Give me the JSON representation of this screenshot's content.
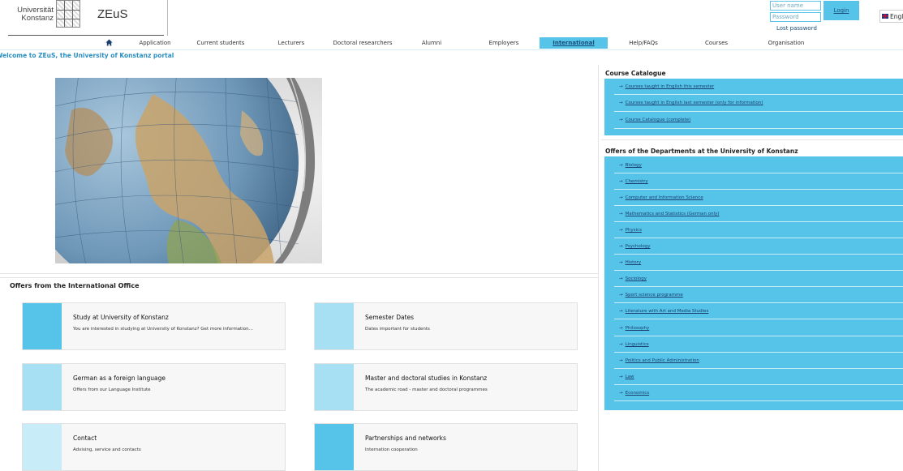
{
  "header": {
    "university_line1": "Universität",
    "university_line2": "Konstanz",
    "app_title": "ZEuS",
    "username_placeholder": "User name",
    "password_placeholder": "Password",
    "login_label": "Login",
    "lost_password": "Lost password",
    "language": "English"
  },
  "nav": {
    "items": [
      "Application",
      "Current students",
      "Lecturers",
      "Doctoral researchers",
      "Alumni",
      "Employers",
      "International",
      "Help/FAQs",
      "Courses",
      "Organisation"
    ],
    "active": "International"
  },
  "welcome": "Welcome to ZEuS, the University of Konstanz portal",
  "international_office": {
    "title": "Offers from the International Office",
    "tiles": [
      {
        "title": "Study at University of Konstanz",
        "desc": "You are interested in studying at University of Konstanz? Get more information...",
        "color": "#56c4e8"
      },
      {
        "title": "Semester Dates",
        "desc": "Dates important for students",
        "color": "#a8e0f3"
      },
      {
        "title": "German as a foreign language",
        "desc": "Offers from our Language Institute",
        "color": "#a8e0f3"
      },
      {
        "title": "Master and doctoral studies in Konstanz",
        "desc": "The academic road - master and doctoral programmes",
        "color": "#a8e0f3"
      },
      {
        "title": "Contact",
        "desc": "Advising, service and contacts",
        "color": "#c8ecf8"
      },
      {
        "title": "Partnerships and networks",
        "desc": "Internation cooperation",
        "color": "#56c4e8"
      }
    ]
  },
  "course_catalogue": {
    "title": "Course Catalogue",
    "links": [
      "Courses taught in English this semester",
      "Courses taught in English last semester (only for information)",
      "Course Catalogue (complete)"
    ]
  },
  "departments": {
    "title": "Offers of the Departments at the University of Konstanz",
    "links": [
      "Biology",
      "Chemistry",
      "Computer and Information Science",
      "Mathematics and Statistics (German only)",
      "Physics",
      "Psychology",
      "History",
      "Sociology",
      "Sport science programme",
      "Literature with Art and Media Studies",
      "Philosophy",
      "Linguistics",
      "Politics and Public Administration",
      "Law",
      "Economics"
    ]
  },
  "colors": {
    "accent": "#56c4e8",
    "link": "#1a3f6e",
    "welcome": "#2a8fc0"
  }
}
